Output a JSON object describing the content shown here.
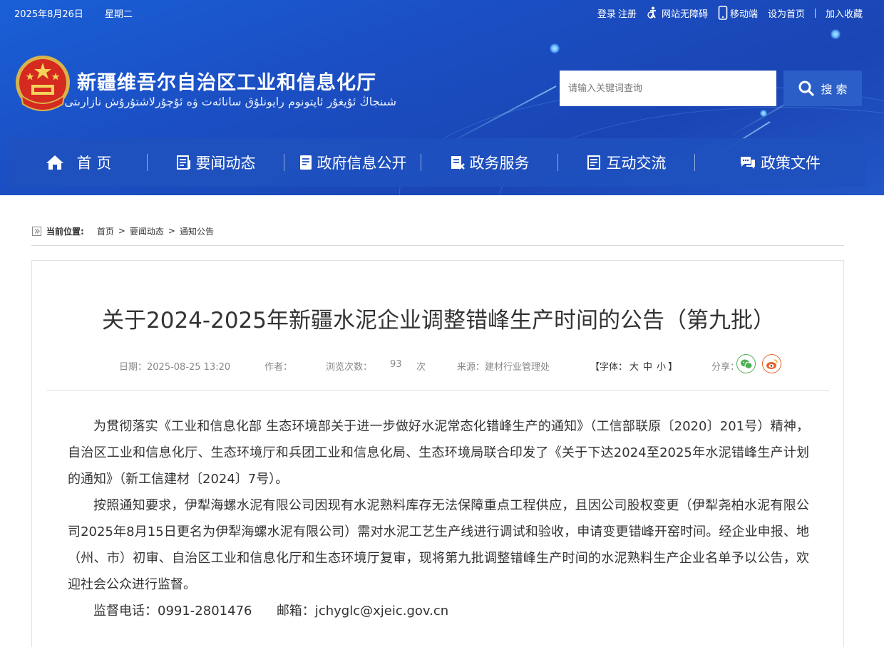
{
  "topbar": {
    "date": "2025年8月26日",
    "weekday": "星期二",
    "links": {
      "login": "登录",
      "register": "注册",
      "accessible": "网站无障碍",
      "mobile": "移动端",
      "set_home": "设为首页",
      "favorite": "加入收藏"
    }
  },
  "site": {
    "title": "新疆维吾尔自治区工业和信息化厅",
    "subtitle": "شىنجاڭ ئۇيغۇر ئاپتونوم رايونلۇق سانائەت ۋە ئۇچۇرلاشتۇرۇش نازارىتى"
  },
  "search": {
    "placeholder": "请输入关键词查询",
    "button_label": "搜 索"
  },
  "nav": {
    "items": [
      {
        "label": "首 页",
        "icon": "home-icon"
      },
      {
        "label": "要闻动态",
        "icon": "news-icon"
      },
      {
        "label": "政府信息公开",
        "icon": "document-icon"
      },
      {
        "label": "政务服务",
        "icon": "service-icon"
      },
      {
        "label": "互动交流",
        "icon": "interaction-icon"
      },
      {
        "label": "政策文件",
        "icon": "chat-icon"
      }
    ]
  },
  "breadcrumb": {
    "label": "当前位置:",
    "items": [
      "首页",
      "要闻动态",
      "通知公告"
    ],
    "separator": ">"
  },
  "article": {
    "title": "关于2024-2025年新疆水泥企业调整错峰生产时间的公告（第九批）",
    "meta": {
      "date": "日期：2025-08-25 13:20",
      "author": "作者：",
      "views_label": "浏览次数：",
      "views": "93",
      "views_unit": "次",
      "source": "来源：建材行业管理处",
      "font_open": "【字体：",
      "font_large": "大",
      "font_medium": "中",
      "font_small": "小",
      "font_close": "】",
      "share_label": "分享："
    },
    "paragraphs": [
      "为贯彻落实《工业和信息化部 生态环境部关于进一步做好水泥常态化错峰生产的通知》（工信部联原〔2020〕201号）精神，自治区工业和信息化厅、生态环境厅和兵团工业和信息化局、生态环境局联合印发了《关于下达2024至2025年水泥错峰生产计划的通知》（新工信建材〔2024〕7号）。",
      "按照通知要求，伊犁海螺水泥有限公司因现有水泥熟料库存无法保障重点工程供应，且因公司股权变更（伊犁尧柏水泥有限公司2025年8月15日更名为伊犁海螺水泥有限公司）需对水泥工艺生产线进行调试和验收，申请变更错峰开窑时间。经企业申报、地（州、市）初审、自治区工业和信息化厅和生态环境厅复审，现将第九批调整错峰生产时间的水泥熟料生产企业名单予以公告，欢迎社会公众进行监督。"
    ],
    "contact": {
      "phone": "监督电话：0991-2801476",
      "email": "邮箱：jchyglc@xjeic.gov.cn"
    }
  },
  "colors": {
    "header_blue": "#1b4fc4",
    "nav_blue": "#1e50be",
    "search_button": "#2b5fc7",
    "wechat_green": "#4caf50",
    "weibo_orange": "#e8622a"
  }
}
